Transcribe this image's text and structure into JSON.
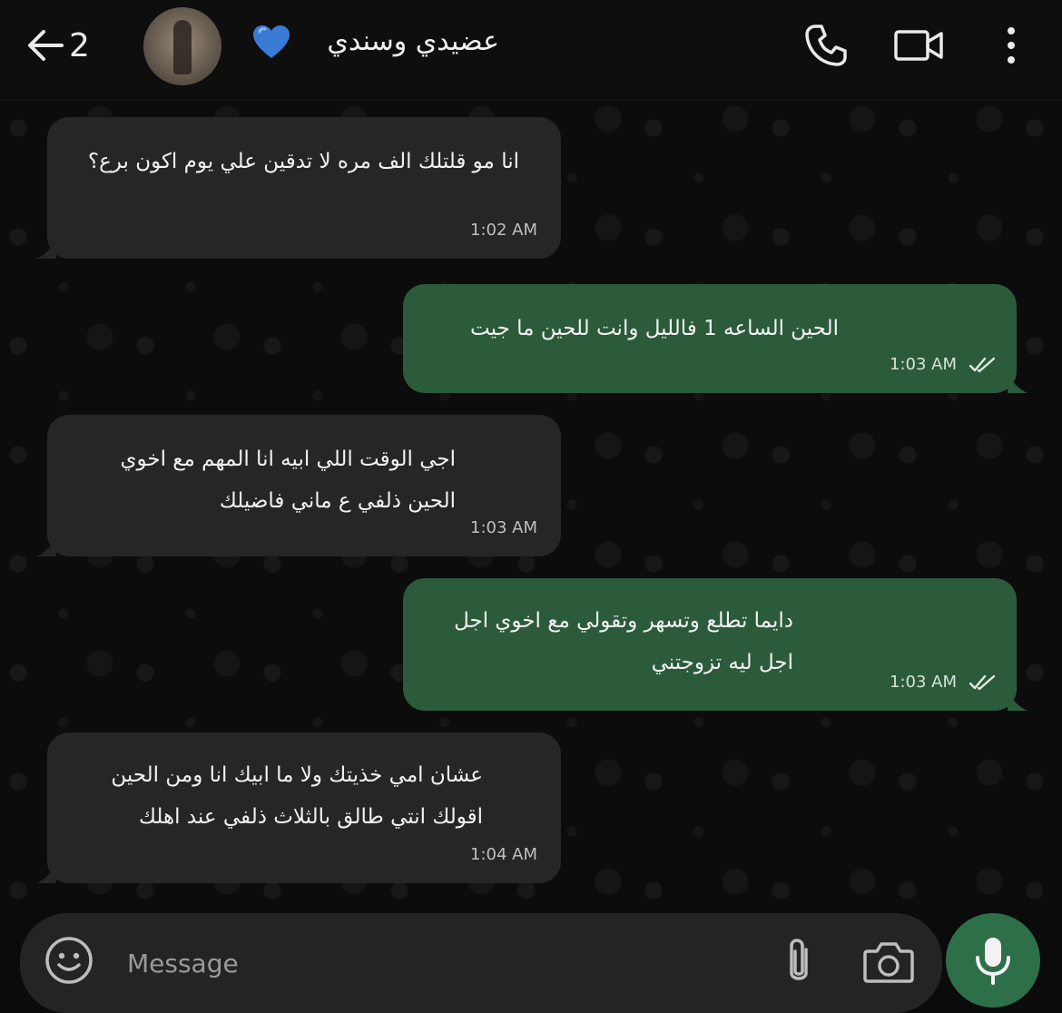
{
  "header": {
    "back_count": "2",
    "contact_name": "عضيدي وسندي",
    "icons": [
      "back-arrow-icon",
      "blue-heart-icon",
      "phone-icon",
      "video-camera-icon",
      "more-vertical-icon"
    ],
    "heart_color": "#3a7bd5"
  },
  "messages": [
    {
      "direction": "incoming",
      "text": "انا مو قلتلك الف مره لا تدقين علي يوم اكون برع؟",
      "time": "1:02 AM"
    },
    {
      "direction": "outgoing",
      "text": "الحين الساعه 1 فالليل وانت للحين ما جيت",
      "time": "1:03 AM",
      "status": "read"
    },
    {
      "direction": "incoming",
      "text": "اجي الوقت اللي ابيه انا المهم مع اخوي الحين ذلفي ع ماني فاضيلك",
      "time": "1:03 AM"
    },
    {
      "direction": "outgoing",
      "text": "دايما تطلع وتسهر وتقولي مع اخوي اجل اجل ليه تزوجتني",
      "time": "1:03 AM",
      "status": "read"
    },
    {
      "direction": "incoming",
      "text": "عشان امي خذيتك ولا ما ابيك انا ومن الحين اقولك انتي طالق بالثلاث ذلفي عند اهلك",
      "time": "1:04 AM"
    }
  ],
  "composer": {
    "placeholder": "Message",
    "icons": [
      "emoji-icon",
      "paperclip-icon",
      "camera-icon",
      "microphone-icon"
    ]
  },
  "colors": {
    "incoming_bubble": "#262626",
    "outgoing_bubble": "#2b5b3a",
    "mic_button": "#2d6f48"
  }
}
